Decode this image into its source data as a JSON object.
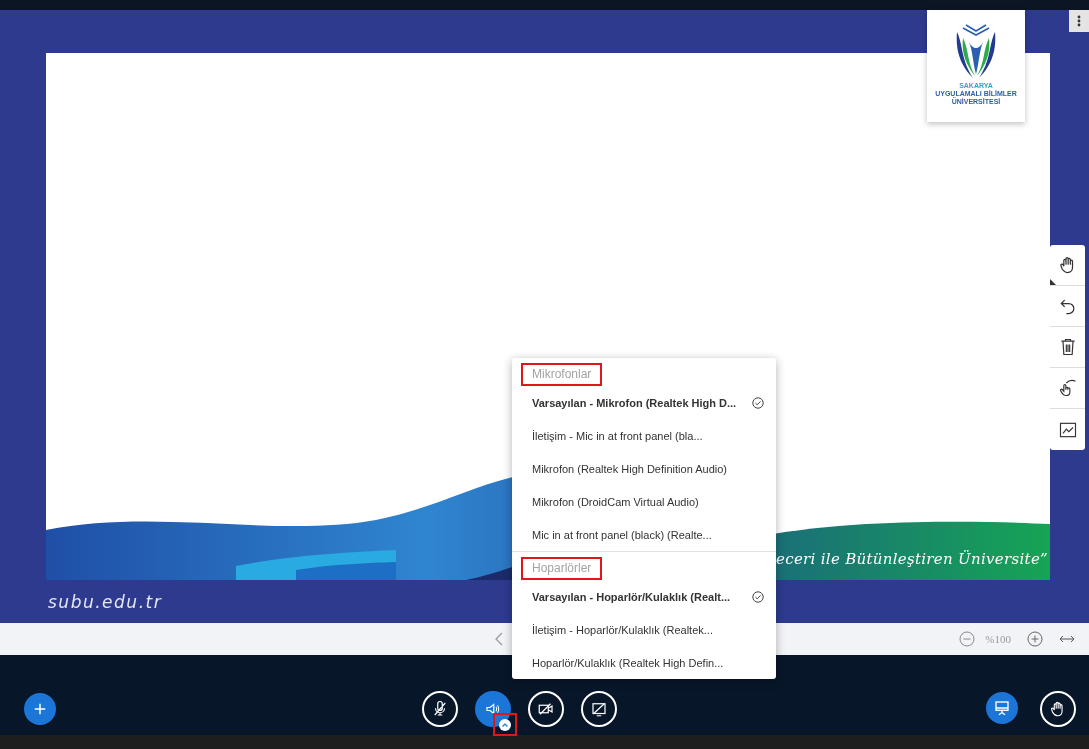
{
  "logo": {
    "lines": [
      "SAKARYA",
      "UYGULAMALI BİLİMLER",
      "ÜNİVERSİTESİ"
    ]
  },
  "slide": {
    "slogan": "eceri ile Bütünleştiren Üniversite”"
  },
  "site_url": "subu.edu.tr",
  "whiteboard_tools": [
    {
      "kind": "hand"
    },
    {
      "kind": "undo"
    },
    {
      "kind": "trash"
    },
    {
      "kind": "multitouch"
    },
    {
      "kind": "chart"
    }
  ],
  "nav_bar": {
    "zoom": "%100"
  },
  "audio_menu": {
    "sections": [
      {
        "title": "Mikrofonlar",
        "highlighted": true,
        "items": [
          {
            "label": "Varsayılan - Mikrofon (Realtek High D...",
            "selected": true
          },
          {
            "label": "İletişim - Mic in at front panel (bla...",
            "selected": false
          },
          {
            "label": "Mikrofon (Realtek High Definition Audio)",
            "selected": false
          },
          {
            "label": "Mikrofon (DroidCam Virtual Audio)",
            "selected": false
          },
          {
            "label": "Mic in at front panel (black) (Realte...",
            "selected": false
          }
        ]
      },
      {
        "title": "Hoparlörler",
        "highlighted": true,
        "items": [
          {
            "label": "Varsayılan - Hoparlör/Kulaklık (Realt...",
            "selected": true
          },
          {
            "label": "İletişim - Hoparlör/Kulaklık (Realtek...",
            "selected": false
          },
          {
            "label": "Hoparlör/Kulaklık (Realtek High Defin...",
            "selected": false
          }
        ]
      }
    ]
  },
  "control_bar": {
    "left": [
      {
        "kind": "plus",
        "active": true
      }
    ],
    "center": [
      {
        "kind": "mic-off",
        "active": false
      },
      {
        "kind": "speaker",
        "active": true,
        "options_highlighted": true
      },
      {
        "kind": "camera-off",
        "active": false
      },
      {
        "kind": "screen-off",
        "active": false
      }
    ],
    "right": [
      {
        "kind": "presentation",
        "active": true
      },
      {
        "kind": "hand",
        "active": false
      }
    ]
  }
}
